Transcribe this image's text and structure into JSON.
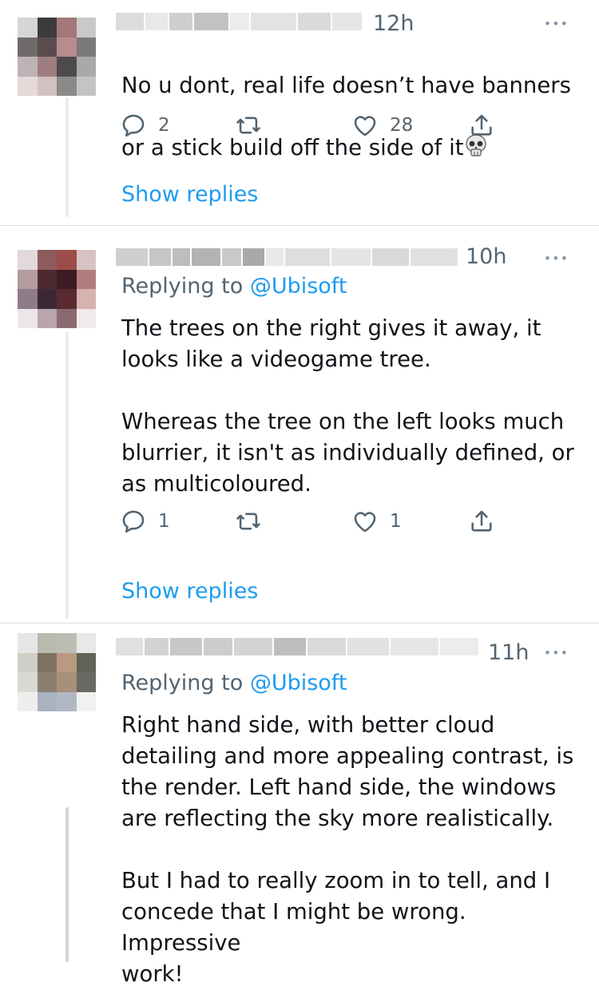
{
  "tweets": [
    {
      "time": "12h",
      "more": "•••",
      "text_line1": "No u dont, real life doesn’t have banners",
      "text_line2": "or a stick build off the side of it",
      "emoji": "skull-icon",
      "replies": "2",
      "likes": "28",
      "show_replies": "Show replies"
    },
    {
      "time": "10h",
      "more": "•••",
      "replying_prefix": "Replying to",
      "replying_handle": "@Ubisoft",
      "text": "The trees on the right gives it away, it\nlooks like a videogame tree.\n\nWhereas the tree on the left looks much\nblurrier, it isn't as individually defined, or\nas multicoloured.",
      "replies": "1",
      "likes": "1",
      "show_replies": "Show replies"
    },
    {
      "time": "11h",
      "more": "•••",
      "replying_prefix": "Replying to",
      "replying_handle": "@Ubisoft",
      "text": "Right hand side, with better cloud\ndetailing and more appealing contrast, is\nthe render. Left hand side, the windows\nare reflecting the sky more realistically.\n\nBut I had to really zoom in to tell, and I\nconcede that I might be wrong. Impressive\nwork!"
    }
  ],
  "colors": {
    "accent": "#1d9bf0",
    "secondary": "#536471",
    "text": "#0f1419"
  }
}
